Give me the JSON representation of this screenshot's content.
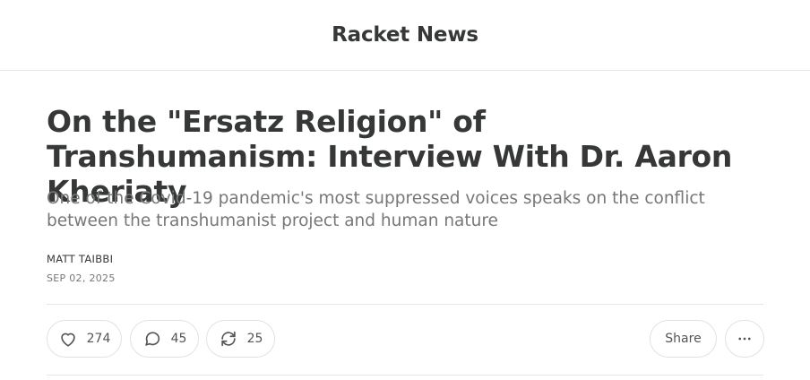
{
  "publication": {
    "name": "Racket News"
  },
  "post": {
    "title": "On the \"Ersatz Religion\" of Transhumanism: Interview With Dr. Aaron Kheriaty",
    "subtitle": "One of the Covid-19 pandemic's most suppressed voices speaks on the conflict between the transhumanist project and human nature",
    "author": "MATT TAIBBI",
    "date": "SEP 02, 2025"
  },
  "actions": {
    "likes": "274",
    "comments": "45",
    "restacks": "25",
    "share_label": "Share",
    "like_icon": "heart-icon",
    "comment_icon": "speech-bubble-icon",
    "restack_icon": "repeat-arrows-icon",
    "more_icon": "ellipsis-icon"
  },
  "colors": {
    "text": "#363737",
    "muted": "#777777",
    "border": "#e6e6e6"
  }
}
